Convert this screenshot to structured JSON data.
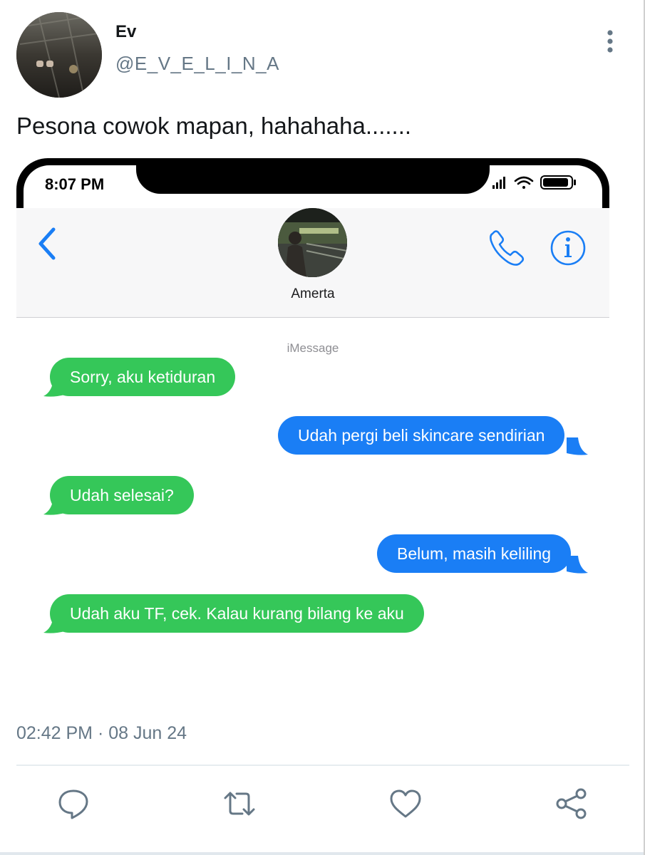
{
  "tweet": {
    "display_name": "Ev",
    "handle": "@E_V_E_L_I_N_A",
    "text": "Pesona cowok mapan, hahahaha.......",
    "timestamp": "02:42 PM · 08 Jun 24",
    "more_icon": "more-vertical-icon"
  },
  "phone": {
    "status_time": "8:07 PM",
    "status_icons": [
      "signal-icon",
      "wifi-icon",
      "battery-icon"
    ],
    "contact_name": "Amerta",
    "service_label": "iMessage",
    "colors": {
      "received": "#35c759",
      "sent": "#1a7ef5",
      "accent": "#1a7ef5"
    },
    "messages": [
      {
        "side": "received",
        "text": "Sorry, aku ketiduran"
      },
      {
        "side": "sent",
        "text": "Udah pergi beli skincare sendirian"
      },
      {
        "side": "received",
        "text": "Udah selesai?"
      },
      {
        "side": "sent",
        "text": "Belum, masih keliling"
      },
      {
        "side": "received",
        "text": "Udah aku TF, cek. Kalau kurang bilang ke aku"
      }
    ]
  },
  "actions": [
    {
      "name": "reply",
      "icon": "reply-icon"
    },
    {
      "name": "retweet",
      "icon": "retweet-icon"
    },
    {
      "name": "like",
      "icon": "heart-icon"
    },
    {
      "name": "share",
      "icon": "share-icon"
    }
  ]
}
